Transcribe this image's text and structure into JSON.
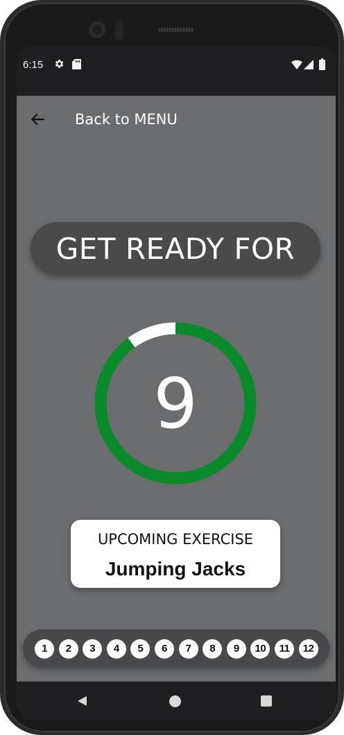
{
  "status_bar": {
    "time": "6:15",
    "left_icons": [
      "gear-icon",
      "sd-card-icon"
    ],
    "right_icons": [
      "wifi-icon",
      "cellular-signal-icon",
      "battery-icon"
    ]
  },
  "app_bar": {
    "back_icon": "arrow-left-icon",
    "title": "Back to MENU"
  },
  "ready_banner": {
    "text": "GET READY FOR"
  },
  "timer": {
    "value": "9",
    "elapsed_fraction": 0.1,
    "ring_color": "#0a8a2a",
    "elapsed_color": "#ffffff"
  },
  "upcoming": {
    "label": "UPCOMING EXERCISE",
    "exercise_name": "Jumping Jacks"
  },
  "exercise_steps": [
    "1",
    "2",
    "3",
    "4",
    "5",
    "6",
    "7",
    "8",
    "9",
    "10",
    "11",
    "12"
  ],
  "nav_bar": {
    "icons": [
      "back-triangle-icon",
      "home-circle-icon",
      "recents-square-icon"
    ]
  },
  "colors": {
    "screen_background": "#6b6c6e",
    "pill_background": "#4a4a4b",
    "status_bar": "#1f1f21"
  }
}
